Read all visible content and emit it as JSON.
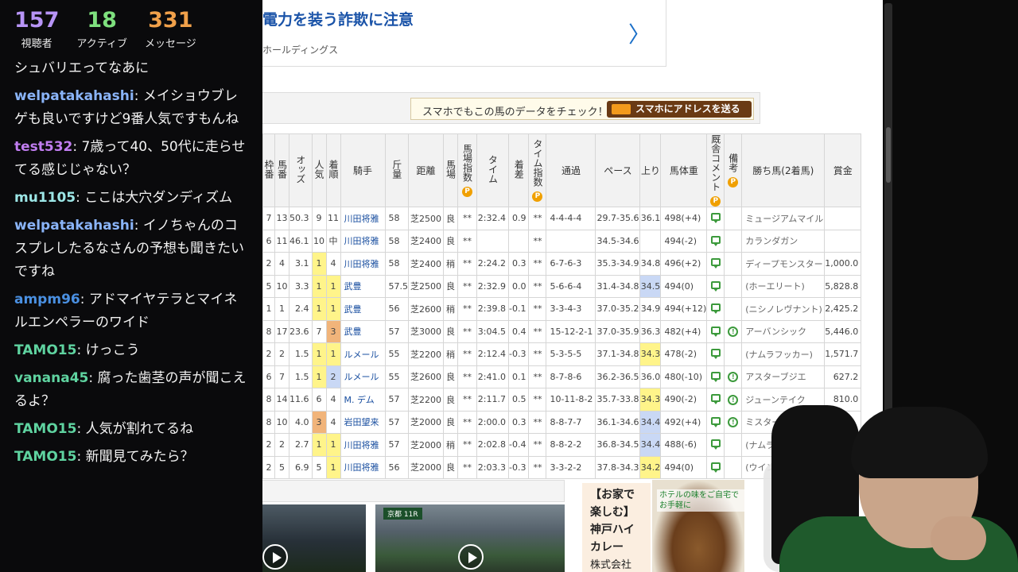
{
  "stream_stats": {
    "viewers": {
      "value": "157",
      "label": "視聴者",
      "color": "#b794f6"
    },
    "active": {
      "value": "18",
      "label": "アクティブ",
      "color": "#7ee07e"
    },
    "messages": {
      "value": "331",
      "label": "メッセージ",
      "color": "#f0a04a"
    }
  },
  "chat": [
    {
      "user": "",
      "text": "シュバリエってなあに",
      "color": "#ffffff"
    },
    {
      "user": "welpatakahashi",
      "text": ": メイショウブレゲも良いですけど9番人気ですもんね",
      "color": "#8ab4f8"
    },
    {
      "user": "test532",
      "text": ": 7歳って40、50代に走らせてる感じじゃない？",
      "color": "#c07df0"
    },
    {
      "user": "mu1105",
      "text": ": ここは大穴ダンディズム",
      "color": "#9ce6e6"
    },
    {
      "user": "welpatakahashi",
      "text": ": イノちゃんのコスプレしたるなさんの予想も聞きたいですね",
      "color": "#8ab4f8"
    },
    {
      "user": "ampm96",
      "text": ": アドマイヤテラとマイネルエンペラーのワイド",
      "color": "#4a90e2"
    },
    {
      "user": "TAMO15",
      "text": ": けっこう",
      "color": "#5fd3a0"
    },
    {
      "user": "vanana45",
      "text": ": 腐った歯茎の声が聞こえるよ？",
      "color": "#5fd3a0"
    },
    {
      "user": "TAMO15",
      "text": ": 人気が割れてるね",
      "color": "#5fd3a0"
    },
    {
      "user": "TAMO15",
      "text": ": 新聞見てみたら？",
      "color": "#5fd3a0"
    }
  ],
  "ad_top": {
    "title": "電力を装う詐欺に注意",
    "sub": "ホールディングス",
    "chevron": "〉"
  },
  "smartphone": {
    "text": "スマホでもこの馬のデータをチェック！",
    "button": "スマホにアドレスを送る"
  },
  "table": {
    "headers": [
      "枠番",
      "馬番",
      "オッズ",
      "人気",
      "着順",
      "騎手",
      "斤量",
      "距離",
      "馬場",
      "馬場指数",
      "タイム",
      "着差",
      "タイム指数",
      "通過",
      "ペース",
      "上り",
      "馬体重",
      "厩舎コメント",
      "備考",
      "勝ち馬(2着馬)",
      "賞金"
    ],
    "p_badge": "P",
    "rows": [
      {
        "waku": "7",
        "uma": "13",
        "odds": "50.3",
        "ninki": "9",
        "chaku": "11",
        "jockey": "川田将雅",
        "kinryo": "58",
        "kyori": "芝2500",
        "baba": "良",
        "babaidx": "**",
        "time": "2:32.4",
        "chakusa": "0.9",
        "timeidx": "**",
        "tsuka": "4-4-4-4",
        "pace": "29.7-35.6",
        "agari": "36.1",
        "weight": "498(+4)",
        "comment": true,
        "note": false,
        "winner": "ミュージアムマイル",
        "prize": ""
      },
      {
        "waku": "6",
        "uma": "11",
        "odds": "46.1",
        "ninki": "10",
        "chaku": "中",
        "jockey": "川田将雅",
        "kinryo": "58",
        "kyori": "芝2400",
        "baba": "良",
        "babaidx": "**",
        "time": "",
        "chakusa": "",
        "timeidx": "**",
        "tsuka": "",
        "pace": "34.5-34.6",
        "agari": "",
        "weight": "494(-2)",
        "comment": true,
        "note": false,
        "winner": "カランダガン",
        "prize": ""
      },
      {
        "waku": "2",
        "uma": "4",
        "odds": "3.1",
        "ninki": "1",
        "chaku": "4",
        "jockey": "川田将雅",
        "kinryo": "58",
        "kyori": "芝2400",
        "baba": "稍",
        "babaidx": "**",
        "time": "2:24.2",
        "chakusa": "0.3",
        "timeidx": "**",
        "tsuka": "6-7-6-3",
        "pace": "35.3-34.9",
        "agari": "34.8",
        "weight": "496(+2)",
        "comment": true,
        "note": false,
        "winner": "ディープモンスター",
        "prize": "1,000.0"
      },
      {
        "waku": "5",
        "uma": "10",
        "odds": "3.3",
        "ninki": "1",
        "chaku": "1",
        "jockey": "武豊",
        "kinryo": "57.5",
        "kyori": "芝2500",
        "baba": "良",
        "babaidx": "**",
        "time": "2:32.9",
        "chakusa": "0.0",
        "timeidx": "**",
        "tsuka": "5-6-6-4",
        "pace": "31.4-34.8",
        "agari": "34.5",
        "weight": "494(0)",
        "comment": true,
        "note": false,
        "winner": "(ホーエリート)",
        "prize": "5,828.8"
      },
      {
        "waku": "1",
        "uma": "1",
        "odds": "2.4",
        "ninki": "1",
        "chaku": "1",
        "jockey": "武豊",
        "kinryo": "56",
        "kyori": "芝2600",
        "baba": "稍",
        "babaidx": "**",
        "time": "2:39.8",
        "chakusa": "-0.1",
        "timeidx": "**",
        "tsuka": "3-3-4-3",
        "pace": "37.0-35.2",
        "agari": "34.9",
        "weight": "494(+12)",
        "comment": true,
        "note": false,
        "winner": "(ニシノレヴナント)",
        "prize": "2,425.2"
      },
      {
        "waku": "8",
        "uma": "17",
        "odds": "23.6",
        "ninki": "7",
        "chaku": "3",
        "jockey": "武豊",
        "kinryo": "57",
        "kyori": "芝3000",
        "baba": "良",
        "babaidx": "**",
        "time": "3:04.5",
        "chakusa": "0.4",
        "timeidx": "**",
        "tsuka": "15-12-2-1",
        "pace": "37.0-35.9",
        "agari": "36.3",
        "weight": "482(+4)",
        "comment": true,
        "note": true,
        "winner": "アーバンシック",
        "prize": "5,446.0"
      },
      {
        "waku": "2",
        "uma": "2",
        "odds": "1.5",
        "ninki": "1",
        "chaku": "1",
        "jockey": "ルメール",
        "kinryo": "55",
        "kyori": "芝2200",
        "baba": "稍",
        "babaidx": "**",
        "time": "2:12.4",
        "chakusa": "-0.3",
        "timeidx": "**",
        "tsuka": "5-3-5-5",
        "pace": "37.1-34.8",
        "agari": "34.3",
        "weight": "478(-2)",
        "comment": true,
        "note": false,
        "winner": "(ナムラフッカー)",
        "prize": "1,571.7"
      },
      {
        "waku": "6",
        "uma": "7",
        "odds": "1.5",
        "ninki": "1",
        "chaku": "2",
        "jockey": "ルメール",
        "kinryo": "55",
        "kyori": "芝2600",
        "baba": "良",
        "babaidx": "**",
        "time": "2:41.0",
        "chakusa": "0.1",
        "timeidx": "**",
        "tsuka": "8-7-8-6",
        "pace": "36.2-36.5",
        "agari": "36.0",
        "weight": "480(-10)",
        "comment": true,
        "note": true,
        "winner": "アスターブジエ",
        "prize": "627.2"
      },
      {
        "waku": "8",
        "uma": "14",
        "odds": "11.6",
        "ninki": "6",
        "chaku": "4",
        "jockey": "M. デム",
        "kinryo": "57",
        "kyori": "芝2200",
        "baba": "良",
        "babaidx": "**",
        "time": "2:11.7",
        "chakusa": "0.5",
        "timeidx": "**",
        "tsuka": "10-11-8-2",
        "pace": "35.7-33.8",
        "agari": "34.3",
        "weight": "490(-2)",
        "comment": true,
        "note": true,
        "winner": "ジューンテイク",
        "prize": "810.0"
      },
      {
        "waku": "8",
        "uma": "10",
        "odds": "4.0",
        "ninki": "3",
        "chaku": "4",
        "jockey": "岩田望来",
        "kinryo": "57",
        "kyori": "芝2000",
        "baba": "良",
        "babaidx": "**",
        "time": "2:00.0",
        "chakusa": "0.3",
        "timeidx": "**",
        "tsuka": "8-8-7-7",
        "pace": "36.1-34.6",
        "agari": "34.4",
        "weight": "492(+4)",
        "comment": true,
        "note": true,
        "winner": "ミスタージーティー",
        "prize": ""
      },
      {
        "waku": "2",
        "uma": "2",
        "odds": "2.7",
        "ninki": "1",
        "chaku": "1",
        "jockey": "川田将雅",
        "kinryo": "57",
        "kyori": "芝2000",
        "baba": "稍",
        "babaidx": "**",
        "time": "2:02.8",
        "chakusa": "-0.4",
        "timeidx": "**",
        "tsuka": "8-8-2-2",
        "pace": "36.8-34.5",
        "agari": "34.4",
        "weight": "488(-6)",
        "comment": true,
        "note": false,
        "winner": "(ナムラエイ",
        "prize": ""
      },
      {
        "waku": "2",
        "uma": "5",
        "odds": "6.9",
        "ninki": "5",
        "chaku": "1",
        "jockey": "川田将雅",
        "kinryo": "56",
        "kyori": "芝2000",
        "baba": "良",
        "babaidx": "**",
        "time": "2:03.3",
        "chakusa": "-0.3",
        "timeidx": "**",
        "tsuka": "3-3-2-2",
        "pace": "37.8-34.3",
        "agari": "34.2",
        "weight": "494(0)",
        "comment": true,
        "note": false,
        "winner": "(ウインリ",
        "prize": ""
      }
    ]
  },
  "video_tag": "京都 11R",
  "ad_curry": {
    "title": "【お家で楽しむ】神戸ハイカレー",
    "company": "株式会社",
    "caption": "ホテルの味をご自宅でお手軽に",
    "ad_mark": "▷×"
  }
}
